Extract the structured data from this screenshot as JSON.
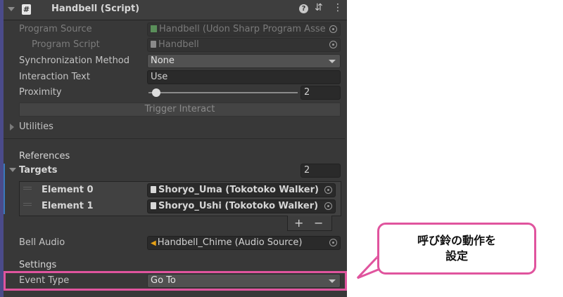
{
  "header": {
    "title": "Handbell (Script)"
  },
  "program_source": {
    "label": "Program Source",
    "value": "Handbell (Udon Sharp Program Asse"
  },
  "program_script": {
    "label": "Program Script",
    "value": "Handbell"
  },
  "sync_method": {
    "label": "Synchronization Method",
    "value": "None"
  },
  "interaction_text": {
    "label": "Interaction Text",
    "value": "Use"
  },
  "proximity": {
    "label": "Proximity",
    "value": "2",
    "slider_fraction": 0.05
  },
  "trigger_button": "Trigger Interact",
  "utilities": "Utilities",
  "references": "References",
  "targets": {
    "label": "Targets",
    "count": "2",
    "elements": [
      {
        "label": "Element 0",
        "value": "Shoryo_Uma (Tokotoko Walker)"
      },
      {
        "label": "Element 1",
        "value": "Shoryo_Ushi (Tokotoko Walker)"
      }
    ],
    "plus": "+",
    "minus": "−"
  },
  "bell_audio": {
    "label": "Bell Audio",
    "value": "Handbell_Chime (Audio Source)"
  },
  "settings": "Settings",
  "event_type": {
    "label": "Event Type",
    "value": "Go To"
  },
  "callout": {
    "line1": "呼び鈴の動作を",
    "line2": "設定"
  },
  "colors": {
    "highlight": "#e0549e",
    "panel": "#383838"
  }
}
